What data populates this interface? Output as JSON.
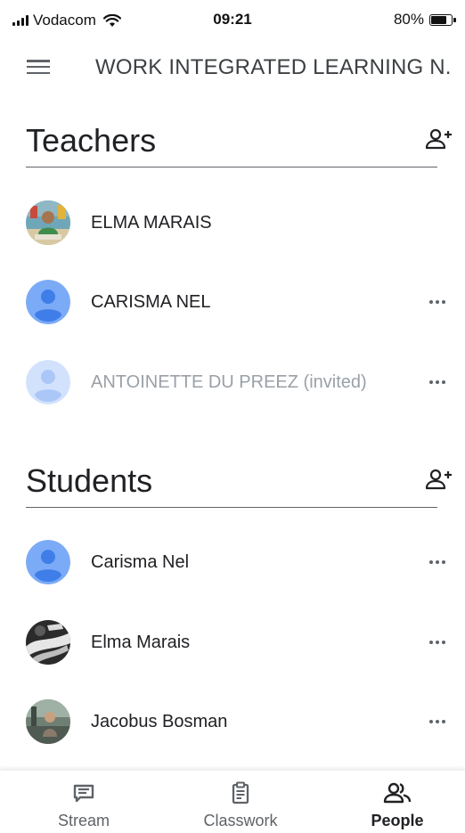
{
  "status_bar": {
    "carrier": "Vodacom",
    "time": "09:21",
    "battery": "80%",
    "battery_level": 0.8
  },
  "app_bar": {
    "title": "WORK INTEGRATED LEARNING N..."
  },
  "teachers": {
    "title": "Teachers",
    "items": [
      {
        "name": "ELMA MARAIS",
        "invited": false,
        "avatar": "photo"
      },
      {
        "name": "CARISMA NEL",
        "invited": false,
        "avatar": "default"
      },
      {
        "name": "ANTOINETTE DU PREEZ (invited)",
        "invited": true,
        "avatar": "default"
      }
    ]
  },
  "students": {
    "title": "Students",
    "items": [
      {
        "name": "Carisma Nel",
        "avatar": "default"
      },
      {
        "name": "Elma Marais",
        "avatar": "photo"
      },
      {
        "name": "Jacobus Bosman",
        "avatar": "photo"
      }
    ]
  },
  "bottom_nav": {
    "items": [
      {
        "label": "Stream",
        "icon": "stream-icon",
        "active": false
      },
      {
        "label": "Classwork",
        "icon": "classwork-icon",
        "active": false
      },
      {
        "label": "People",
        "icon": "people-icon",
        "active": true
      }
    ]
  },
  "colors": {
    "avatar_blue": "#7baaf7",
    "avatar_blue_dark": "#3f7ee8",
    "text": "#202124",
    "icon_grey": "#5f6368",
    "invited_grey": "#9aa0a6"
  }
}
